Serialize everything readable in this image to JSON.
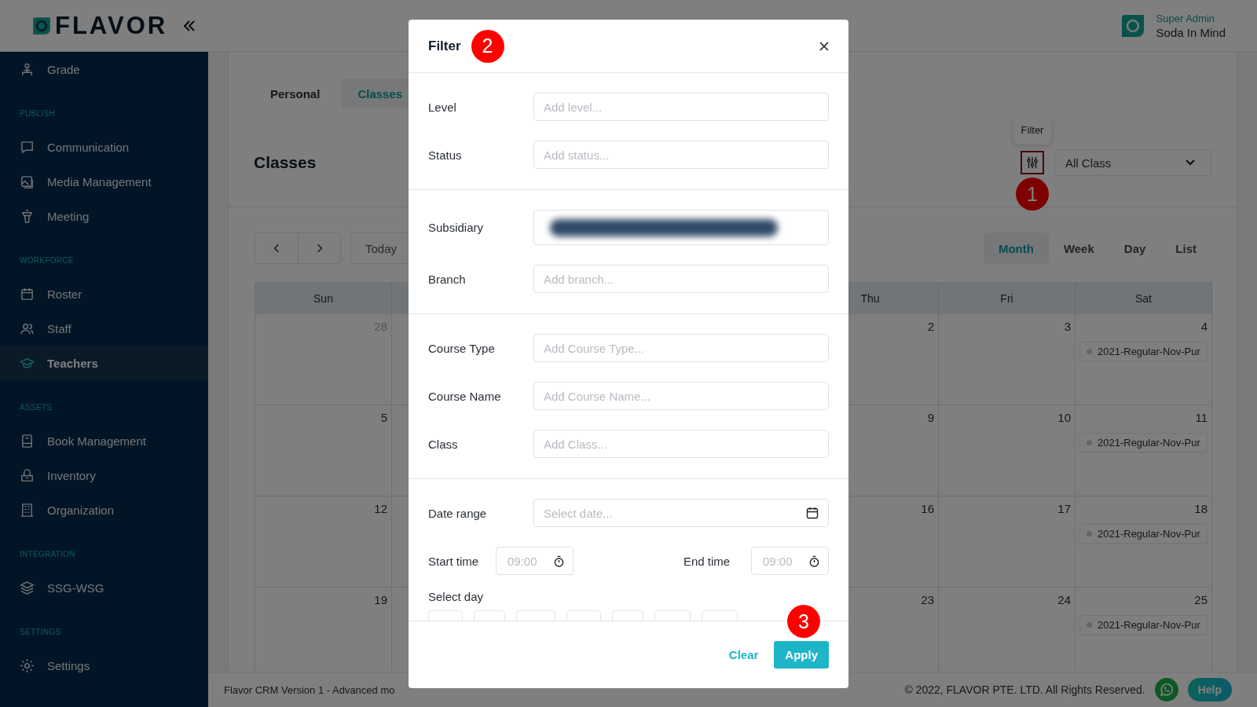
{
  "header": {
    "logo": "FLAVOR",
    "user_role": "Super Admin",
    "user_name": "Soda In Mind"
  },
  "sidebar": {
    "sections": [
      {
        "items": [
          {
            "label": "Grade",
            "selected": false
          }
        ]
      },
      {
        "heading": "PUBLISH",
        "items": [
          {
            "label": "Communication",
            "selected": false
          },
          {
            "label": "Media Management",
            "selected": false
          },
          {
            "label": "Meeting",
            "selected": false
          }
        ]
      },
      {
        "heading": "WORKFORCE",
        "items": [
          {
            "label": "Roster",
            "selected": false
          },
          {
            "label": "Staff",
            "selected": false
          },
          {
            "label": "Teachers",
            "selected": true
          }
        ]
      },
      {
        "heading": "ASSETS",
        "items": [
          {
            "label": "Book Management",
            "selected": false
          },
          {
            "label": "Inventory",
            "selected": false
          },
          {
            "label": "Organization",
            "selected": false
          }
        ]
      },
      {
        "heading": "INTEGRATION",
        "items": [
          {
            "label": "SSG-WSG",
            "selected": false
          }
        ]
      },
      {
        "heading": "SETTINGS",
        "items": [
          {
            "label": "Settings",
            "selected": false
          }
        ]
      }
    ]
  },
  "page": {
    "tabs": [
      {
        "label": "Personal",
        "selected": false
      },
      {
        "label": "Classes",
        "selected": true
      }
    ],
    "title": "Classes",
    "filter_button": {
      "tooltip": "Filter",
      "marker": "1"
    },
    "class_select": {
      "value": "All Class"
    },
    "calendar": {
      "today": "Today",
      "views": [
        {
          "label": "Month",
          "selected": true
        },
        {
          "label": "Week",
          "selected": false
        },
        {
          "label": "Day",
          "selected": false
        },
        {
          "label": "List",
          "selected": false
        }
      ],
      "columns": [
        "Sun",
        "Thu",
        "Fri",
        "Sat"
      ],
      "weeks": [
        [
          {
            "date": "28",
            "muted": true
          },
          {
            "date": "2",
            "muted": false
          },
          {
            "date": "3",
            "muted": false
          },
          {
            "date": "4",
            "muted": false,
            "events": [
              "2021-Regular-Nov-Pur"
            ]
          }
        ],
        [
          {
            "date": "5",
            "muted": false
          },
          {
            "date": "9",
            "muted": false
          },
          {
            "date": "10",
            "muted": false
          },
          {
            "date": "11",
            "muted": false,
            "events": [
              "2021-Regular-Nov-Pur"
            ]
          }
        ],
        [
          {
            "date": "12",
            "muted": false
          },
          {
            "date": "16",
            "muted": false
          },
          {
            "date": "17",
            "muted": false
          },
          {
            "date": "18",
            "muted": false,
            "events": [
              "2021-Regular-Nov-Pur"
            ]
          }
        ],
        [
          {
            "date": "19",
            "muted": false
          },
          {
            "date": "23",
            "muted": false
          },
          {
            "date": "24",
            "muted": false
          },
          {
            "date": "25",
            "muted": false,
            "events": [
              "2021-Regular-Nov-Pur"
            ]
          }
        ]
      ]
    }
  },
  "footer": {
    "version": "Flavor CRM Version 1 - Advanced mo",
    "copyright": "© 2022, FLAVOR PTE. LTD. All Rights Reserved.",
    "help": "Help"
  },
  "modal": {
    "title": "Filter",
    "marker": "2",
    "sections": [
      [
        {
          "kind": "text",
          "label": "Level",
          "placeholder": "Add level..."
        },
        {
          "kind": "text",
          "label": "Status",
          "placeholder": "Add status..."
        }
      ],
      [
        {
          "kind": "redacted",
          "label": "Subsidiary"
        },
        {
          "kind": "text",
          "label": "Branch",
          "placeholder": "Add branch..."
        }
      ],
      [
        {
          "kind": "text",
          "label": "Course Type",
          "placeholder": "Add Course Type..."
        },
        {
          "kind": "text",
          "label": "Course Name",
          "placeholder": "Add Course Name..."
        },
        {
          "kind": "text",
          "label": "Class",
          "placeholder": "Add Class..."
        }
      ],
      [
        {
          "kind": "date",
          "label": "Date range",
          "placeholder": "Select date..."
        },
        {
          "kind": "time-range",
          "label": "Start time",
          "placeholder": "09:00",
          "end_label": "End time",
          "end_placeholder": "09:00"
        },
        {
          "kind": "days",
          "label": "Select day"
        }
      ]
    ],
    "clear": "Clear",
    "apply": "Apply",
    "apply_marker": "3"
  }
}
